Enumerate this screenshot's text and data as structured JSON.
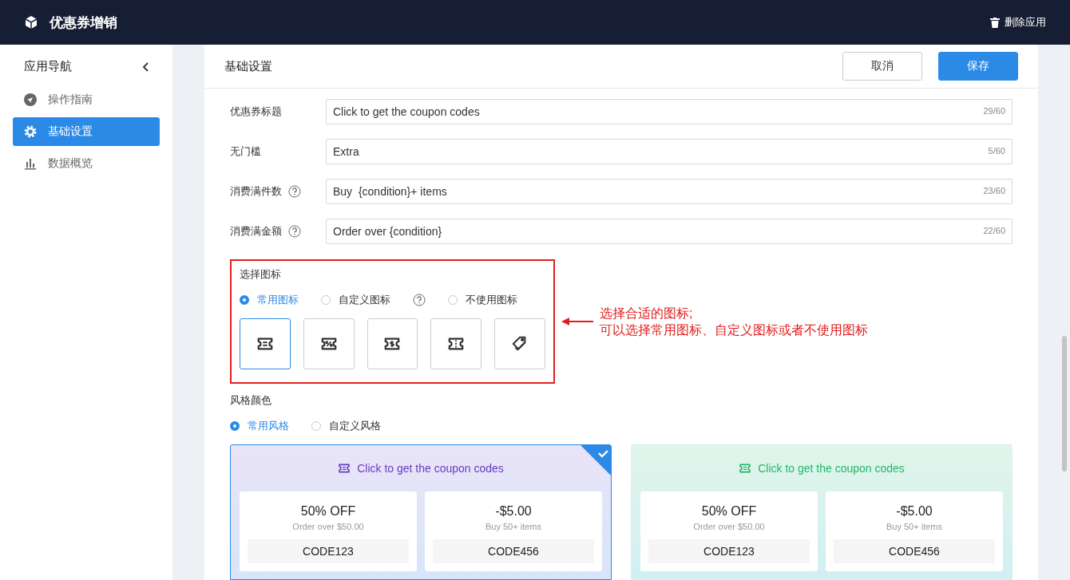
{
  "header": {
    "title": "优惠券增销",
    "delete_button": "删除应用"
  },
  "sidebar": {
    "title": "应用导航",
    "items": [
      {
        "label": "操作指南",
        "kind": "guide",
        "selected": false
      },
      {
        "label": "基础设置",
        "kind": "settings",
        "selected": true
      },
      {
        "label": "数据概览",
        "kind": "chart",
        "selected": false
      }
    ]
  },
  "panel": {
    "title": "基础设置",
    "cancel_button": "取消",
    "save_button": "保存"
  },
  "fields": [
    {
      "label": "优惠券标题",
      "help": false,
      "value": "Click to get the coupon codes",
      "count": "29/60"
    },
    {
      "label": "无门槛",
      "help": false,
      "value": "Extra",
      "count": "5/60"
    },
    {
      "label": "消费满件数",
      "help": true,
      "value": "Buy  {condition}+ items",
      "count": "23/60"
    },
    {
      "label": "消费满金额",
      "help": true,
      "value": "Order over {condition}",
      "count": "22/60"
    }
  ],
  "icon_section": {
    "title": "选择图标",
    "options": [
      {
        "label": "常用图标",
        "selected": true,
        "help": false
      },
      {
        "label": "自定义图标",
        "selected": false,
        "help": true
      },
      {
        "label": "不使用图标",
        "selected": false,
        "help": false
      }
    ],
    "icons": [
      {
        "kind": "lines",
        "selected": true
      },
      {
        "kind": "percent",
        "selected": false
      },
      {
        "kind": "dollar",
        "selected": false
      },
      {
        "kind": "dashed",
        "selected": false
      },
      {
        "kind": "tags",
        "selected": false
      }
    ]
  },
  "annotation": {
    "lines": [
      "选择合适的图标;",
      "可以选择常用图标、自定义图标或者不使用图标"
    ]
  },
  "style_section": {
    "title": "风格颜色",
    "options": [
      {
        "label": "常用风格",
        "selected": true
      },
      {
        "label": "自定义风格",
        "selected": false
      }
    ],
    "presets": [
      {
        "selected": true,
        "color": "#6a3bc4",
        "title": "Click to get the coupon codes",
        "coupons": [
          {
            "amount": "50% OFF",
            "condition": "Order over $50.00",
            "code": "CODE123"
          },
          {
            "amount": "-$5.00",
            "condition": "Buy 50+ items",
            "code": "CODE456"
          }
        ]
      },
      {
        "selected": false,
        "color": "#22b86a",
        "title": "Click to get the coupon codes",
        "coupons": [
          {
            "amount": "50% OFF",
            "condition": "Order over $50.00",
            "code": "CODE123"
          },
          {
            "amount": "-$5.00",
            "condition": "Buy 50+ items",
            "code": "CODE456"
          }
        ]
      }
    ]
  }
}
